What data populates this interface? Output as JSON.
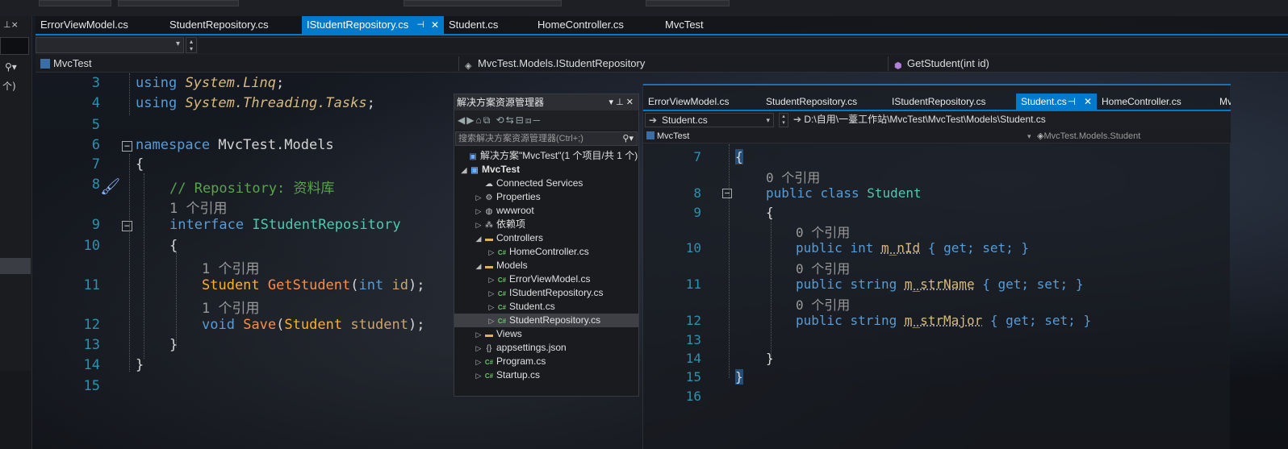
{
  "main": {
    "tabs": [
      {
        "label": "ErrorViewModel.cs"
      },
      {
        "label": "StudentRepository.cs"
      },
      {
        "label": "IStudentRepository.cs"
      },
      {
        "label": "Student.cs"
      },
      {
        "label": "HomeController.cs"
      },
      {
        "label": "MvcTest"
      }
    ],
    "active_tab": "IStudentRepository.cs",
    "nav": {
      "project": "MvcTest",
      "type": "MvcTest.Models.IStudentRepository",
      "member": "GetStudent(int id)"
    },
    "code": {
      "l3": {
        "num": "3",
        "kw": "using",
        "ns": "System.Linq"
      },
      "l4": {
        "num": "4",
        "kw": "using",
        "ns": "System.Threading.Tasks"
      },
      "l5": {
        "num": "5"
      },
      "l6": {
        "num": "6",
        "kw": "namespace",
        "name": "MvcTest.Models"
      },
      "l7": {
        "num": "7",
        "text": "{"
      },
      "l8": {
        "num": "8",
        "comment": "// Repository: 资料库"
      },
      "ref1": "1 个引用",
      "l9": {
        "num": "9",
        "kw": "interface",
        "name": "IStudentRepository"
      },
      "l10": {
        "num": "10",
        "text": "{"
      },
      "ref2": "1 个引用",
      "l11": {
        "num": "11",
        "type": "Student",
        "method": "GetStudent",
        "open": "(",
        "kw": "int",
        "param": "id",
        "close": ");"
      },
      "ref3": "1 个引用",
      "l12": {
        "num": "12",
        "kw": "void",
        "method": "Save",
        "open": "(",
        "type": "Student",
        "param": "student",
        "close": ");"
      },
      "l13": {
        "num": "13",
        "text": "}"
      },
      "l14": {
        "num": "14",
        "text": "}"
      },
      "l15": {
        "num": "15"
      }
    }
  },
  "solution_explorer": {
    "title": "解决方案资源管理器",
    "search_placeholder": "搜索解决方案资源管理器(Ctrl+;)",
    "items": [
      {
        "label": "解决方案\"MvcTest\"(1 个项目/共 1 个)",
        "icon": "solution-icon"
      },
      {
        "label": "MvcTest",
        "icon": "project-icon"
      },
      {
        "label": "Connected Services",
        "icon": "connected-services-icon"
      },
      {
        "label": "Properties",
        "icon": "properties-icon"
      },
      {
        "label": "wwwroot",
        "icon": "globe-icon"
      },
      {
        "label": "依赖项",
        "icon": "dependencies-icon"
      },
      {
        "label": "Controllers",
        "icon": "folder-icon"
      },
      {
        "label": "HomeController.cs",
        "icon": "csharp-file-icon"
      },
      {
        "label": "Models",
        "icon": "folder-icon"
      },
      {
        "label": "ErrorViewModel.cs",
        "icon": "csharp-file-icon"
      },
      {
        "label": "IStudentRepository.cs",
        "icon": "csharp-file-icon"
      },
      {
        "label": "Student.cs",
        "icon": "csharp-file-icon"
      },
      {
        "label": "StudentRepository.cs",
        "icon": "csharp-file-icon"
      },
      {
        "label": "Views",
        "icon": "folder-icon"
      },
      {
        "label": "appsettings.json",
        "icon": "json-file-icon"
      },
      {
        "label": "Program.cs",
        "icon": "csharp-file-icon"
      },
      {
        "label": "Startup.cs",
        "icon": "csharp-file-icon"
      }
    ]
  },
  "secondary": {
    "tabs": [
      {
        "label": "ErrorViewModel.cs"
      },
      {
        "label": "StudentRepository.cs"
      },
      {
        "label": "IStudentRepository.cs"
      },
      {
        "label": "Student.cs"
      },
      {
        "label": "HomeController.cs"
      },
      {
        "label": "Mv"
      }
    ],
    "active_tab": "Student.cs",
    "file_combo": "Student.cs",
    "path": "D:\\自用\\一薹工作站\\MvcTest\\MvcTest\\Models\\Student.cs",
    "nav_project": "MvcTest",
    "nav_type": "MvcTest.Models.Student",
    "code": {
      "l7": {
        "num": "7",
        "text": "{"
      },
      "ref_a": "0 个引用",
      "l8": {
        "num": "8",
        "kw1": "public",
        "kw2": "class",
        "name": "Student"
      },
      "l9": {
        "num": "9",
        "text": "{"
      },
      "ref_b": "0 个引用",
      "l10": {
        "num": "10",
        "kw1": "public",
        "kw2": "int",
        "prop": "m_nId",
        "acc": "{ get; set; }"
      },
      "ref_c": "0 个引用",
      "l11": {
        "num": "11",
        "kw1": "public",
        "kw2": "string",
        "prop": "m_strName",
        "acc": "{ get; set; }"
      },
      "ref_d": "0 个引用",
      "l12": {
        "num": "12",
        "kw1": "public",
        "kw2": "string",
        "prop": "m_strMajor",
        "acc": "{ get; set; }"
      },
      "l13": {
        "num": "13"
      },
      "l14": {
        "num": "14",
        "text": "}"
      },
      "l15": {
        "num": "15",
        "text": "}"
      },
      "l16": {
        "num": "16"
      }
    }
  },
  "colors": {
    "accent": "#007acc",
    "keyword": "#569cd6",
    "type": "#4ec9b0",
    "comment": "#57a64a",
    "line_number": "#2b91af"
  }
}
